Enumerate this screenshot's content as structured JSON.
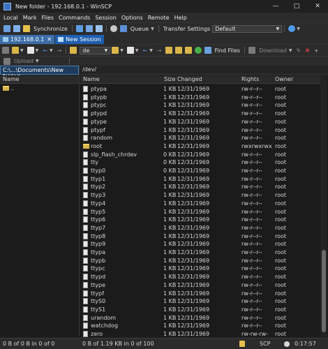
{
  "window": {
    "title": "New folder - 192.168.0.1 - WinSCP"
  },
  "menu": [
    "Local",
    "Mark",
    "Files",
    "Commands",
    "Session",
    "Options",
    "Remote",
    "Help"
  ],
  "toolbar1": {
    "synchronize": "Synchronize",
    "queue": "Queue",
    "transfer_settings": "Transfer Settings",
    "transfer_profile": "Default"
  },
  "tabs": {
    "session": "192.168.0.1",
    "new_session": "New Session"
  },
  "toolbar2": {
    "local_drive": "de",
    "find_files": "Find Files",
    "download": "Download"
  },
  "toolbar3": {
    "upload": "Upload"
  },
  "local": {
    "path": "C:\\...\\Documents\\New folder\\",
    "columns": {
      "name": "Name"
    },
    "rows": [
      {
        "name": ".."
      }
    ]
  },
  "remote": {
    "path": "/dev/",
    "columns": {
      "name": "Name",
      "size": "Size",
      "changed": "Changed",
      "rights": "Rights",
      "owner": "Owner"
    },
    "rows": [
      {
        "name": "ptypa",
        "size": "1 KB",
        "changed": "12/31/1969",
        "rights": "rw-r--r--",
        "owner": "root"
      },
      {
        "name": "ptypb",
        "size": "1 KB",
        "changed": "12/31/1969",
        "rights": "rw-r--r--",
        "owner": "root"
      },
      {
        "name": "ptypc",
        "size": "1 KB",
        "changed": "12/31/1969",
        "rights": "rw-r--r--",
        "owner": "root"
      },
      {
        "name": "ptypd",
        "size": "1 KB",
        "changed": "12/31/1969",
        "rights": "rw-r--r--",
        "owner": "root"
      },
      {
        "name": "ptype",
        "size": "1 KB",
        "changed": "12/31/1969",
        "rights": "rw-r--r--",
        "owner": "root"
      },
      {
        "name": "ptypf",
        "size": "1 KB",
        "changed": "12/31/1969",
        "rights": "rw-r--r--",
        "owner": "root"
      },
      {
        "name": "random",
        "size": "1 KB",
        "changed": "12/31/1969",
        "rights": "rw-r--r--",
        "owner": "root"
      },
      {
        "name": "root",
        "size": "1 KB",
        "changed": "12/31/1969",
        "rights": "rwxrwxrwx",
        "owner": "root"
      },
      {
        "name": "slp_flash_chrdev",
        "size": "0 KB",
        "changed": "12/31/1969",
        "rights": "rw-r--r--",
        "owner": "root"
      },
      {
        "name": "tty",
        "size": "0 KB",
        "changed": "12/31/1969",
        "rights": "rw-r--r--",
        "owner": "root"
      },
      {
        "name": "ttyp0",
        "size": "0 KB",
        "changed": "12/31/1969",
        "rights": "rw-r--r--",
        "owner": "root"
      },
      {
        "name": "ttyp1",
        "size": "1 KB",
        "changed": "12/31/1969",
        "rights": "rw-r--r--",
        "owner": "root"
      },
      {
        "name": "ttyp2",
        "size": "1 KB",
        "changed": "12/31/1969",
        "rights": "rw-r--r--",
        "owner": "root"
      },
      {
        "name": "ttyp3",
        "size": "1 KB",
        "changed": "12/31/1969",
        "rights": "rw-r--r--",
        "owner": "root"
      },
      {
        "name": "ttyp4",
        "size": "1 KB",
        "changed": "12/31/1969",
        "rights": "rw-r--r--",
        "owner": "root"
      },
      {
        "name": "ttyp5",
        "size": "1 KB",
        "changed": "12/31/1969",
        "rights": "rw-r--r--",
        "owner": "root"
      },
      {
        "name": "ttyp6",
        "size": "1 KB",
        "changed": "12/31/1969",
        "rights": "rw-r--r--",
        "owner": "root"
      },
      {
        "name": "ttyp7",
        "size": "1 KB",
        "changed": "12/31/1969",
        "rights": "rw-r--r--",
        "owner": "root"
      },
      {
        "name": "ttyp8",
        "size": "1 KB",
        "changed": "12/31/1969",
        "rights": "rw-r--r--",
        "owner": "root"
      },
      {
        "name": "ttyp9",
        "size": "1 KB",
        "changed": "12/31/1969",
        "rights": "rw-r--r--",
        "owner": "root"
      },
      {
        "name": "ttypa",
        "size": "1 KB",
        "changed": "12/31/1969",
        "rights": "rw-r--r--",
        "owner": "root"
      },
      {
        "name": "ttypb",
        "size": "1 KB",
        "changed": "12/31/1969",
        "rights": "rw-r--r--",
        "owner": "root"
      },
      {
        "name": "ttypc",
        "size": "1 KB",
        "changed": "12/31/1969",
        "rights": "rw-r--r--",
        "owner": "root"
      },
      {
        "name": "ttypd",
        "size": "1 KB",
        "changed": "12/31/1969",
        "rights": "rw-r--r--",
        "owner": "root"
      },
      {
        "name": "ttype",
        "size": "1 KB",
        "changed": "12/31/1969",
        "rights": "rw-r--r--",
        "owner": "root"
      },
      {
        "name": "ttypf",
        "size": "1 KB",
        "changed": "12/31/1969",
        "rights": "rw-r--r--",
        "owner": "root"
      },
      {
        "name": "ttyS0",
        "size": "1 KB",
        "changed": "12/31/1969",
        "rights": "rw-r--r--",
        "owner": "root"
      },
      {
        "name": "ttyS1",
        "size": "1 KB",
        "changed": "12/31/1969",
        "rights": "rw-r--r--",
        "owner": "root"
      },
      {
        "name": "urandom",
        "size": "1 KB",
        "changed": "12/31/1969",
        "rights": "rw-r--r--",
        "owner": "root"
      },
      {
        "name": "watchdog",
        "size": "1 KB",
        "changed": "12/31/1969",
        "rights": "rw-r--r--",
        "owner": "root"
      },
      {
        "name": "zero",
        "size": "1 KB",
        "changed": "12/31/1969",
        "rights": "rw-rw-rw-",
        "owner": "root"
      }
    ]
  },
  "status": {
    "local": "0 B of 0 B in 0 of 0",
    "remote": "0 B of 1.19 KB in 0 of 100",
    "protocol": "SCP",
    "time": "0:17:57"
  },
  "colors": {
    "accent": "#1f5fb0",
    "tab_active": "#3d6ea8",
    "folder": "#d9b54a"
  }
}
